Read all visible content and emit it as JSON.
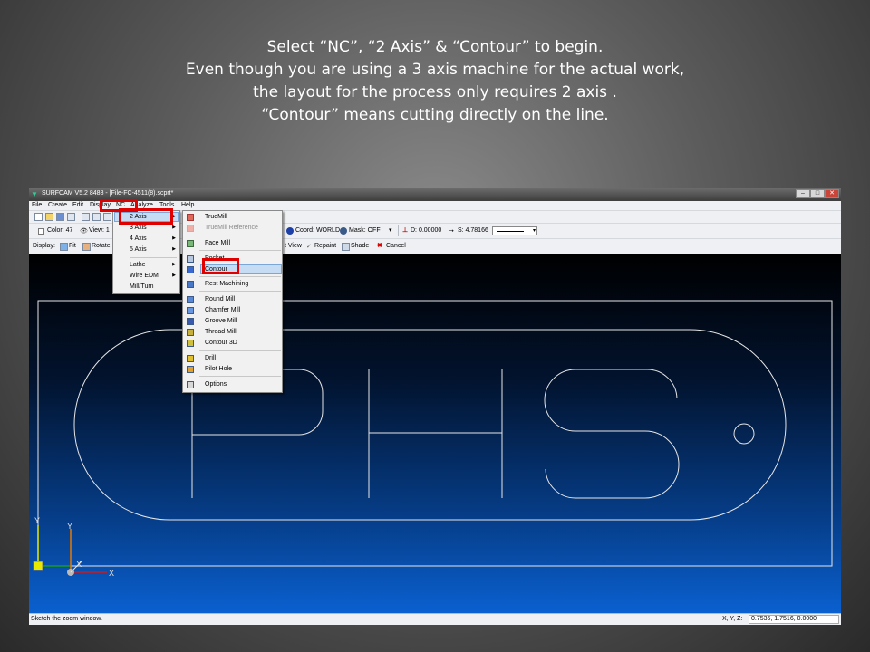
{
  "caption": {
    "line1": "Select “NC”, “2 Axis” & “Contour” to begin.",
    "line2": "Even though you are using a 3 axis machine for the actual work,",
    "line3": "the layout for the process only requires 2 axis .",
    "line4": "“Contour” means cutting directly on the line."
  },
  "window": {
    "title": "SURFCAM V5.2 8488 - [File-FC-4511(8).scprt*",
    "controls": [
      "–",
      "□",
      "✕"
    ]
  },
  "menubar": [
    "File",
    "Create",
    "Edit",
    "Display",
    "NC",
    "Analyze",
    "Tools",
    "Help"
  ],
  "toolbar2": {
    "color": "Color: 47",
    "view": "View: 1",
    "coord": "Coord: WORLD",
    "mask": "Mask: OFF",
    "depth": "D: 0.00000",
    "scale": "S: 4.78166"
  },
  "toolbar3": {
    "display": "Display:",
    "fit": "Fit",
    "rotate": "Rotate",
    "last_view": "t View",
    "repaint": "Repaint",
    "shade": "Shade",
    "cancel": "Cancel"
  },
  "nc_menu": [
    {
      "label": "2 Axis",
      "has_sub": true
    },
    {
      "label": "3 Axis",
      "has_sub": true
    },
    {
      "label": "4 Axis",
      "has_sub": true
    },
    {
      "label": "5 Axis",
      "has_sub": true
    },
    {
      "label": "Lathe",
      "has_sub": true
    },
    {
      "label": "Wire EDM",
      "has_sub": true
    },
    {
      "label": "Mill/Turn",
      "has_sub": false
    }
  ],
  "submenu": [
    {
      "label": "TrueMill",
      "icon": "truemill-icon"
    },
    {
      "label": "TrueMill Reference",
      "icon": "truemill-reference-icon",
      "disabled": true
    },
    {
      "label": "Face Mill",
      "icon": "face-mill-icon"
    },
    {
      "label": "Pocket",
      "icon": "pocket-icon"
    },
    {
      "label": "Contour",
      "icon": "contour-icon"
    },
    {
      "label": "Rest Machining",
      "icon": "rest-machining-icon"
    },
    {
      "label": "Round Mill",
      "icon": "round-mill-icon"
    },
    {
      "label": "Chamfer Mill",
      "icon": "chamfer-mill-icon"
    },
    {
      "label": "Groove Mill",
      "icon": "groove-mill-icon"
    },
    {
      "label": "Thread Mill",
      "icon": "thread-mill-icon"
    },
    {
      "label": "Contour 3D",
      "icon": "contour-3d-icon"
    },
    {
      "label": "Drill",
      "icon": "drill-icon"
    },
    {
      "label": "Pilot Hole",
      "icon": "pilot-hole-icon"
    },
    {
      "label": "Options",
      "icon": "options-icon"
    }
  ],
  "axes": {
    "x": "X",
    "y": "Y",
    "z": "Z"
  },
  "status": {
    "message": "Sketch the zoom window.",
    "xyz_label": "X, Y, Z:",
    "xyz_value": "0.7535, 1.7516, 0.0000"
  },
  "colors": {
    "highlight_box": "#e00000",
    "viewport_top": "#000000",
    "viewport_bottom": "#0a60d0",
    "geometry": "#e6e6e6"
  }
}
